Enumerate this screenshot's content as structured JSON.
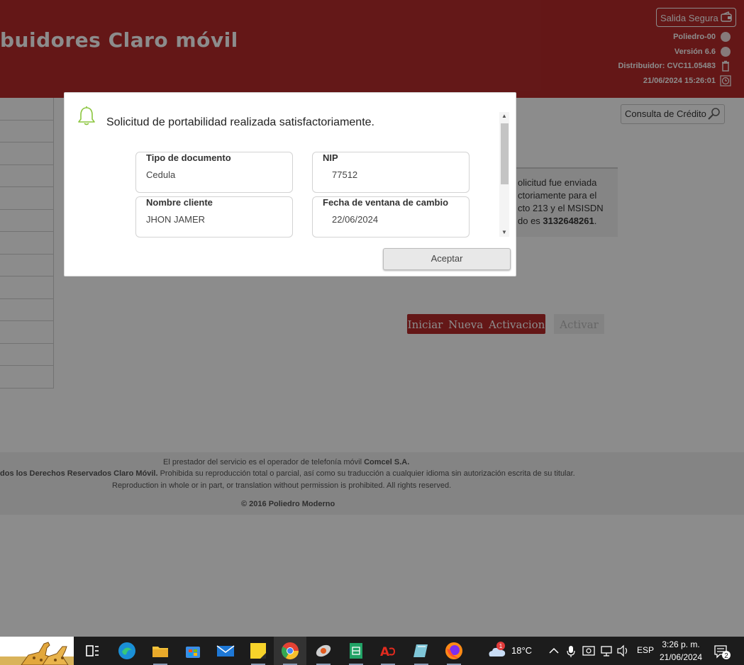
{
  "header": {
    "title": "buidores Claro móvil",
    "logout_label": "Salida Segura",
    "poliedro": "Poliedro-00",
    "version": "Versión 6.6",
    "distribuidor": "Distribuidor: CVC11.05483",
    "datetime": "21/06/2024 15:26:01"
  },
  "credit_check_label": "Consulta de Crédito",
  "result_message": {
    "line1": "olicitud fue enviada",
    "line2": "ctoriamente para el",
    "line3": "cto 213 y el MSISDN",
    "line4_prefix": "do es ",
    "msisdn": "3132648261",
    "line4_suffix": "."
  },
  "buttons": {
    "new_activation": "Iniciar Nueva Activacion",
    "activate": "Activar"
  },
  "footer": {
    "line1_prefix": "El prestador del servicio es el operador de telefonía móvil ",
    "operator": "Comcel S.A.",
    "line2_bold": "dos los Derechos Reservados Claro Móvil.",
    "line2_rest": " Prohibida su reproducción total o parcial, así como su traducción a cualquier idioma sin autorización escrita de su titular.",
    "line3": "Reproduction in whole or in part, or translation without permission is prohibited. All rights reserved.",
    "copyright": "© 2016 Poliedro Moderno"
  },
  "modal": {
    "title": "Solicitud de portabilidad realizada satisfactoriamente.",
    "fields": [
      {
        "label": "Tipo de documento",
        "value": "Cedula"
      },
      {
        "label": "NIP",
        "value": "77512"
      },
      {
        "label": "Nombre cliente",
        "value": "JHON JAMER"
      },
      {
        "label": "Fecha de ventana de cambio",
        "value": "22/06/2024"
      }
    ],
    "accept_label": "Aceptar"
  },
  "taskbar": {
    "weather_temp": "18°C",
    "weather_badge": "1",
    "language": "ESP",
    "time": "3:26 p. m.",
    "date": "21/06/2024",
    "notifications": "2",
    "apps": [
      "task-view-icon",
      "edge-icon",
      "file-explorer-icon",
      "store-icon",
      "mail-icon",
      "sticky-notes-icon",
      "chrome-icon",
      "app-launcher-icon",
      "sheets-icon",
      "acrobat-icon",
      "notepad-icon",
      "firefox-icon"
    ]
  },
  "colors": {
    "brand_red": "#b62b2b",
    "bell_green": "#8cc63f"
  }
}
